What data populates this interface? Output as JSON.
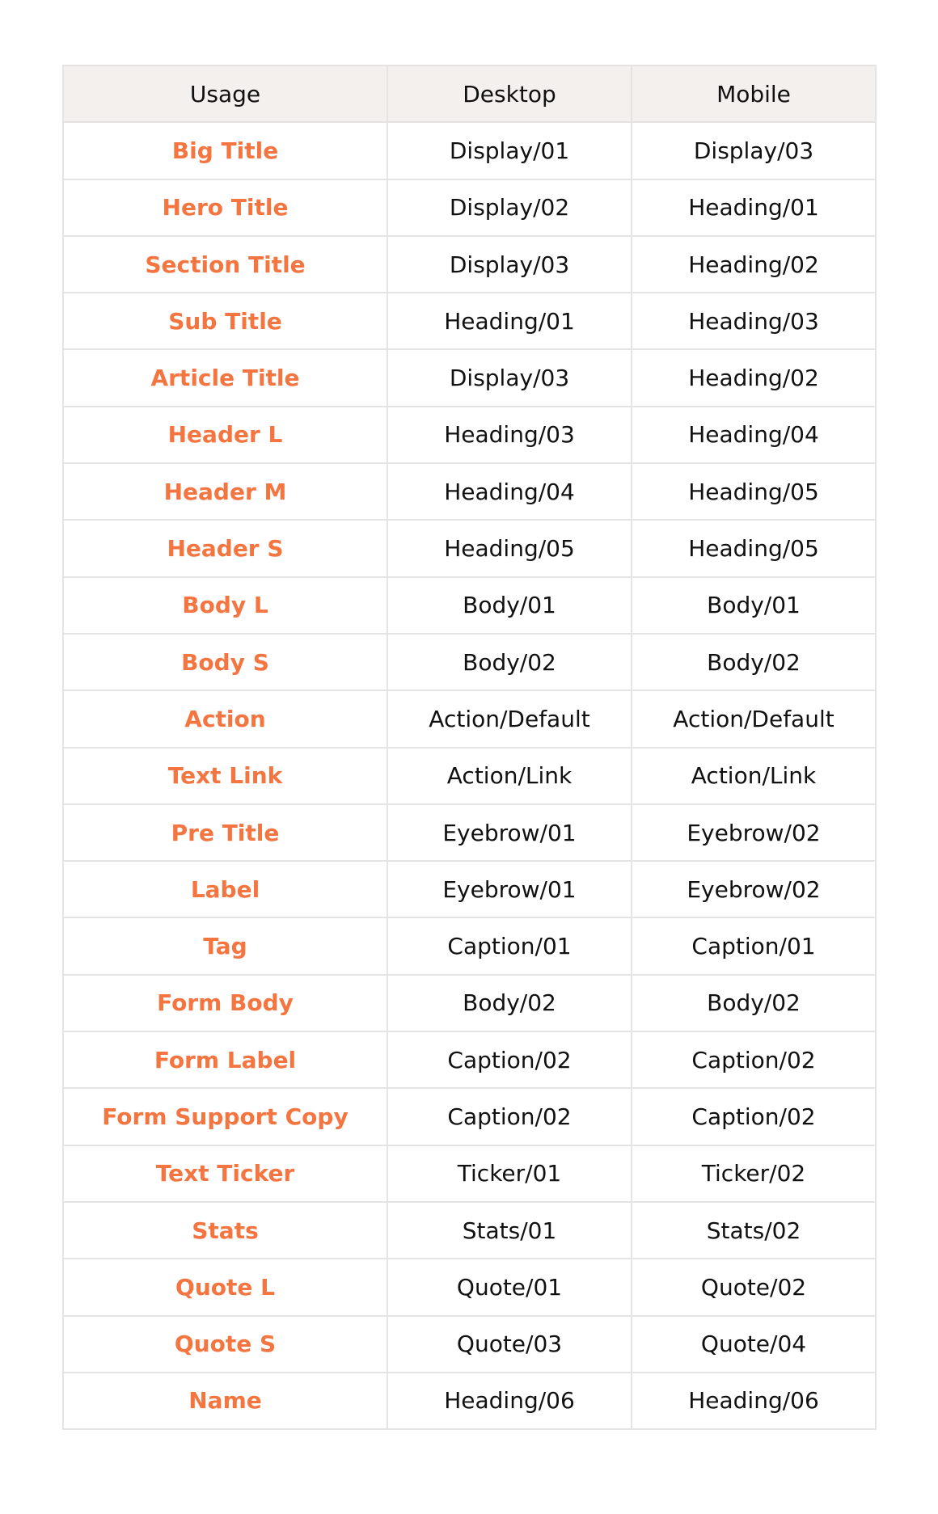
{
  "headers": [
    "Usage",
    "Desktop",
    "Mobile"
  ],
  "accent_color": "#f47540",
  "rows": [
    [
      "Big Title",
      "Display/01",
      "Display/03"
    ],
    [
      "Hero Title",
      "Display/02",
      "Heading/01"
    ],
    [
      "Section Title",
      "Display/03",
      "Heading/02"
    ],
    [
      "Sub Title",
      "Heading/01",
      "Heading/03"
    ],
    [
      "Article Title",
      "Display/03",
      "Heading/02"
    ],
    [
      "Header L",
      "Heading/03",
      "Heading/04"
    ],
    [
      "Header M",
      "Heading/04",
      "Heading/05"
    ],
    [
      "Header S",
      "Heading/05",
      "Heading/05"
    ],
    [
      "Body L",
      "Body/01",
      "Body/01"
    ],
    [
      "Body S",
      "Body/02",
      "Body/02"
    ],
    [
      "Action",
      "Action/Default",
      "Action/Default"
    ],
    [
      "Text Link",
      "Action/Link",
      "Action/Link"
    ],
    [
      "Pre Title",
      "Eyebrow/01",
      "Eyebrow/02"
    ],
    [
      "Label",
      "Eyebrow/01",
      "Eyebrow/02"
    ],
    [
      "Tag",
      "Caption/01",
      "Caption/01"
    ],
    [
      "Form Body",
      "Body/02",
      "Body/02"
    ],
    [
      "Form Label",
      "Caption/02",
      "Caption/02"
    ],
    [
      "Form Support Copy",
      "Caption/02",
      "Caption/02"
    ],
    [
      "Text Ticker",
      "Ticker/01",
      "Ticker/02"
    ],
    [
      "Stats",
      "Stats/01",
      "Stats/02"
    ],
    [
      "Quote L",
      "Quote/01",
      "Quote/02"
    ],
    [
      "Quote S",
      "Quote/03",
      "Quote/04"
    ],
    [
      "Name",
      "Heading/06",
      "Heading/06"
    ]
  ]
}
